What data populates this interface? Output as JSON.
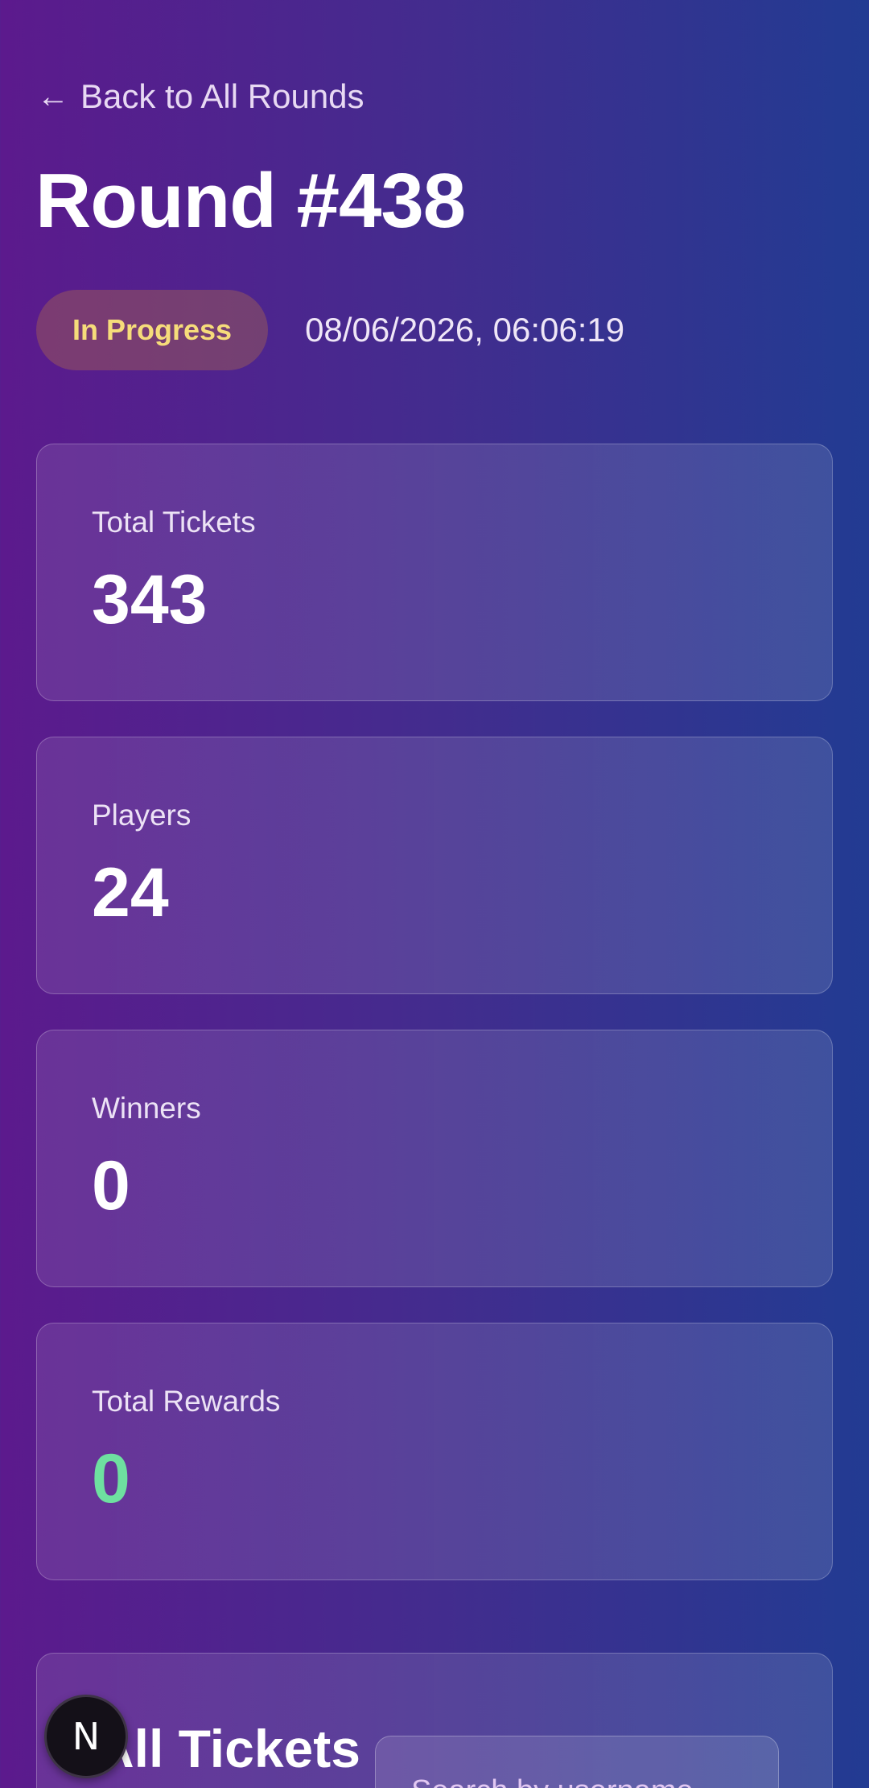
{
  "nav": {
    "back_arrow": "←",
    "back_label": "Back to All Rounds"
  },
  "round": {
    "title": "Round #438",
    "status": "In Progress",
    "timestamp": "08/06/2026, 06:06:19"
  },
  "stats": [
    {
      "label": "Total Tickets",
      "value": "343"
    },
    {
      "label": "Players",
      "value": "24"
    },
    {
      "label": "Winners",
      "value": "0"
    },
    {
      "label": "Total Rewards",
      "value": "0"
    }
  ],
  "tickets": {
    "title": "All Tickets",
    "search_placeholder": "Search by username"
  },
  "fab": {
    "label": "N",
    "icon": "next-logo-icon"
  },
  "colors": {
    "status_text": "#f6dc7a",
    "rewards_value": "#6ee0a0",
    "gradient_left": "#5c1a8d",
    "gradient_right": "#223b92"
  }
}
